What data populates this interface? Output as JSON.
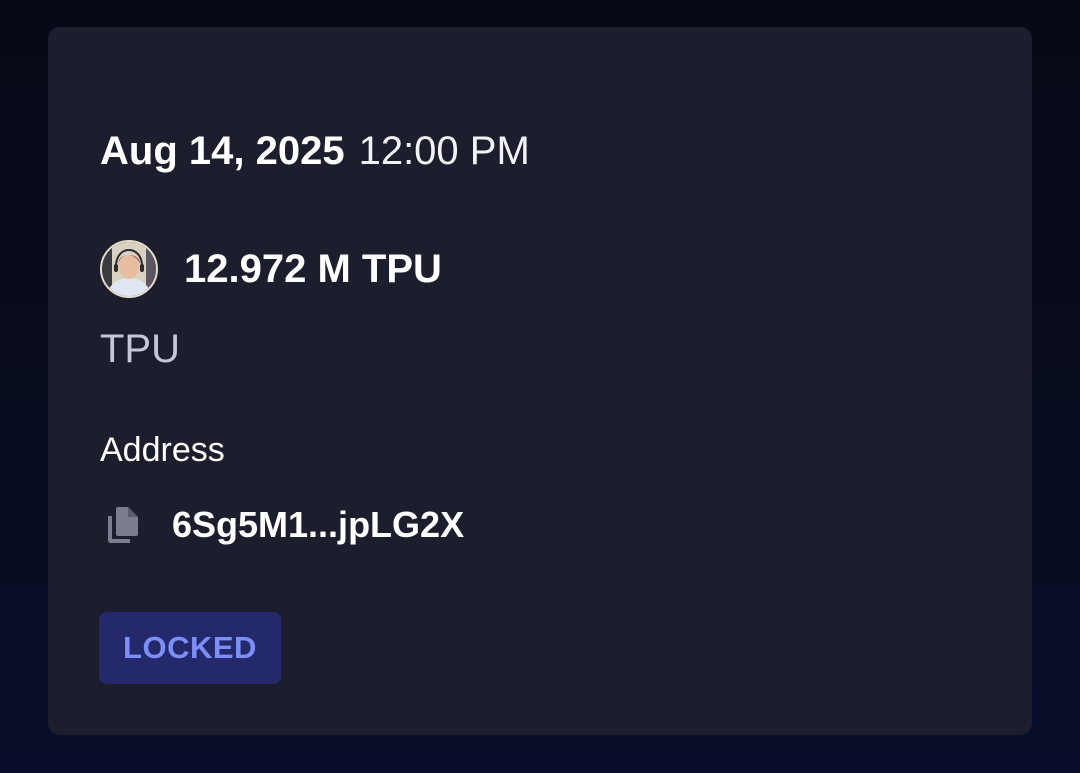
{
  "vesting": {
    "date": "Aug 14, 2025",
    "time": "12:00 PM",
    "amount": "12.972 M TPU",
    "token_symbol": "TPU",
    "avatar_icon": "user-avatar",
    "address_label": "Address",
    "address": "6Sg5M1...jpLG2X",
    "copy_icon": "copy-icon",
    "status": "LOCKED"
  },
  "colors": {
    "background": "#080c1e",
    "card": "#1c1e2e",
    "badge_bg": "#23296a",
    "badge_text": "#7d8ff7",
    "muted_text": "#c3c7d8"
  }
}
